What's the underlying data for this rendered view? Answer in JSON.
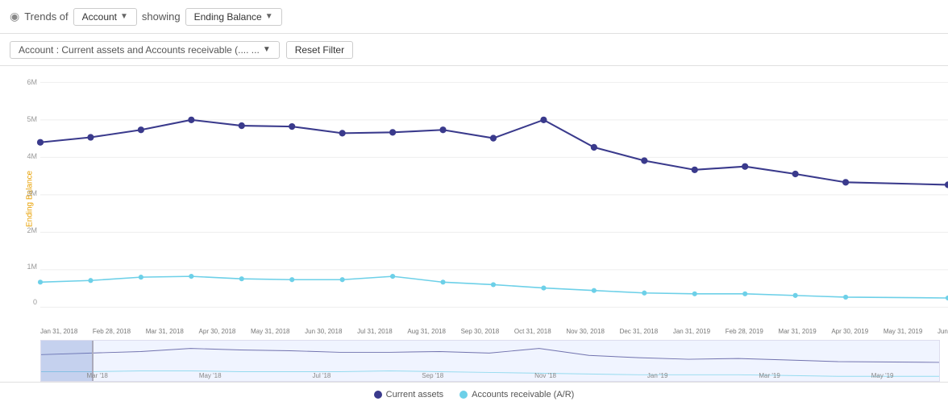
{
  "header": {
    "title": "Trends of",
    "showing_label": "showing",
    "account_btn": "Account",
    "ending_balance_btn": "Ending Balance"
  },
  "filter": {
    "filter_tag": "Account : Current assets and Accounts receivable (.... ...",
    "reset_btn": "Reset Filter"
  },
  "chart": {
    "y_axis_label": "Ending Balance",
    "y_axis_values": [
      "6M",
      "5M",
      "4M",
      "3M",
      "2M",
      "1M",
      "0"
    ],
    "x_axis_labels": [
      "Jan 31, 2018",
      "Feb 28, 2018",
      "Mar 31, 2018",
      "Apr 30, 2018",
      "May 31, 2018",
      "Jun 30, 2018",
      "Jul 31, 2018",
      "Aug 31, 2018",
      "Sep 30, 2018",
      "Oct 31, 2018",
      "Nov 30, 2018",
      "Dec 31, 2018",
      "Jan 31, 2019",
      "Feb 28, 2019",
      "Mar 31, 2019",
      "Apr 30, 2019",
      "May 31, 2019",
      "Jun"
    ],
    "series": {
      "current_assets": {
        "name": "Current assets",
        "color": "#3a3a8c",
        "values": [
          4.35,
          4.5,
          4.7,
          5.0,
          4.85,
          4.82,
          4.65,
          4.68,
          4.75,
          4.45,
          5.0,
          4.2,
          3.85,
          3.6,
          3.7,
          3.5,
          3.3,
          3.25
        ]
      },
      "ar": {
        "name": "Accounts receivable (A/R)",
        "color": "#6dd0e8",
        "values": [
          0.65,
          0.68,
          0.72,
          0.73,
          0.7,
          0.68,
          0.68,
          0.75,
          0.65,
          0.62,
          0.58,
          0.55,
          0.52,
          0.5,
          0.5,
          0.48,
          0.45,
          0.44
        ]
      }
    },
    "minimap_labels": [
      "Mar '18",
      "May '18",
      "Jul '18",
      "Sep '18",
      "Nov '18",
      "Jan '19",
      "Mar '19",
      "May '19"
    ]
  }
}
